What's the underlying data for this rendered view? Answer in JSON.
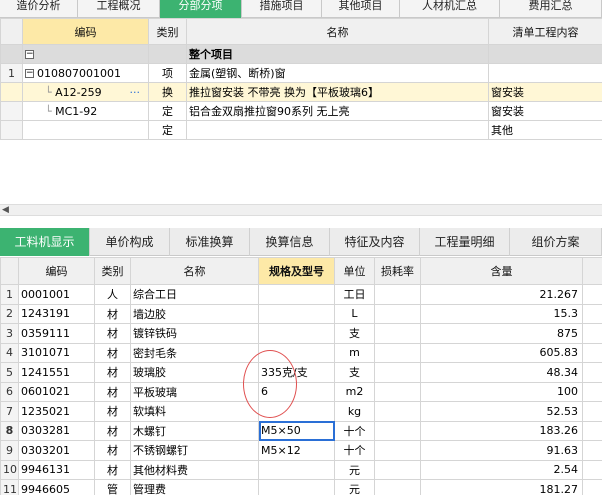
{
  "top_tabs": [
    {
      "label": "造价分析",
      "active": false
    },
    {
      "label": "工程概况",
      "active": false
    },
    {
      "label": "分部分项",
      "active": true
    },
    {
      "label": "措施项目",
      "active": false
    },
    {
      "label": "其他项目",
      "active": false
    },
    {
      "label": "人材机汇总",
      "active": false
    },
    {
      "label": "费用汇总",
      "active": false
    }
  ],
  "upper_grid": {
    "headers": {
      "code": "编码",
      "type": "类别",
      "name": "名称",
      "content": "清单工程内容"
    },
    "group_toggle": "−",
    "group_name": "整个项目",
    "rows": [
      {
        "num": "1",
        "toggle": "−",
        "code": "010807001001",
        "type": "项",
        "name": "金属(塑钢、断桥)窗",
        "content": ""
      },
      {
        "num": "",
        "code": "A12-259",
        "dots": "···",
        "type": "换",
        "name": "推拉窗安装 不带亮  换为【平板玻璃6】",
        "content": "窗安装"
      },
      {
        "num": "",
        "code": "MC1-92",
        "type": "定",
        "name": "铝合金双扇推拉窗90系列 无上亮",
        "content": "窗安装"
      },
      {
        "num": "",
        "code": "",
        "type": "定",
        "name": "",
        "content": "其他"
      }
    ]
  },
  "scroll_arrow": "◀",
  "lower_tabs": [
    {
      "label": "工料机显示",
      "active": true
    },
    {
      "label": "单价构成",
      "active": false
    },
    {
      "label": "标准换算",
      "active": false
    },
    {
      "label": "换算信息",
      "active": false
    },
    {
      "label": "特征及内容",
      "active": false
    },
    {
      "label": "工程量明细",
      "active": false
    },
    {
      "label": "组价方案",
      "active": false
    }
  ],
  "lower_grid": {
    "headers": {
      "code": "编码",
      "type": "类别",
      "name": "名称",
      "spec": "规格及型号",
      "unit": "单位",
      "loss": "损耗率",
      "qty": "含量"
    },
    "rows": [
      {
        "num": "1",
        "code": "0001001",
        "type": "人",
        "name": "综合工日",
        "spec": "",
        "unit": "工日",
        "loss": "",
        "qty": "21.267"
      },
      {
        "num": "2",
        "code": "1243191",
        "type": "材",
        "name": "墙边胶",
        "spec": "",
        "unit": "L",
        "loss": "",
        "qty": "15.3"
      },
      {
        "num": "3",
        "code": "0359111",
        "type": "材",
        "name": "镀锌铁码",
        "spec": "",
        "unit": "支",
        "loss": "",
        "qty": "875"
      },
      {
        "num": "4",
        "code": "3101071",
        "type": "材",
        "name": "密封毛条",
        "spec": "",
        "unit": "m",
        "loss": "",
        "qty": "605.83"
      },
      {
        "num": "5",
        "code": "1241551",
        "type": "材",
        "name": "玻璃胶",
        "spec": "335克/支",
        "unit": "支",
        "loss": "",
        "qty": "48.34"
      },
      {
        "num": "6",
        "code": "0601021",
        "type": "材",
        "name": "平板玻璃",
        "spec": "6",
        "unit": "m2",
        "loss": "",
        "qty": "100"
      },
      {
        "num": "7",
        "code": "1235021",
        "type": "材",
        "name": "软填料",
        "spec": "",
        "unit": "kg",
        "loss": "",
        "qty": "52.53"
      },
      {
        "num": "8",
        "code": "0303281",
        "type": "材",
        "name": "木螺钉",
        "spec": "M5×50",
        "unit": "十个",
        "loss": "",
        "qty": "183.26"
      },
      {
        "num": "9",
        "code": "0303201",
        "type": "材",
        "name": "不锈钢螺钉",
        "spec": "M5×12",
        "unit": "十个",
        "loss": "",
        "qty": "91.63"
      },
      {
        "num": "10",
        "code": "9946131",
        "type": "材",
        "name": "其他材料费",
        "spec": "",
        "unit": "元",
        "loss": "",
        "qty": "2.54"
      },
      {
        "num": "11",
        "code": "9946605",
        "type": "管",
        "name": "管理费",
        "spec": "",
        "unit": "元",
        "loss": "",
        "qty": "181.27"
      }
    ]
  }
}
